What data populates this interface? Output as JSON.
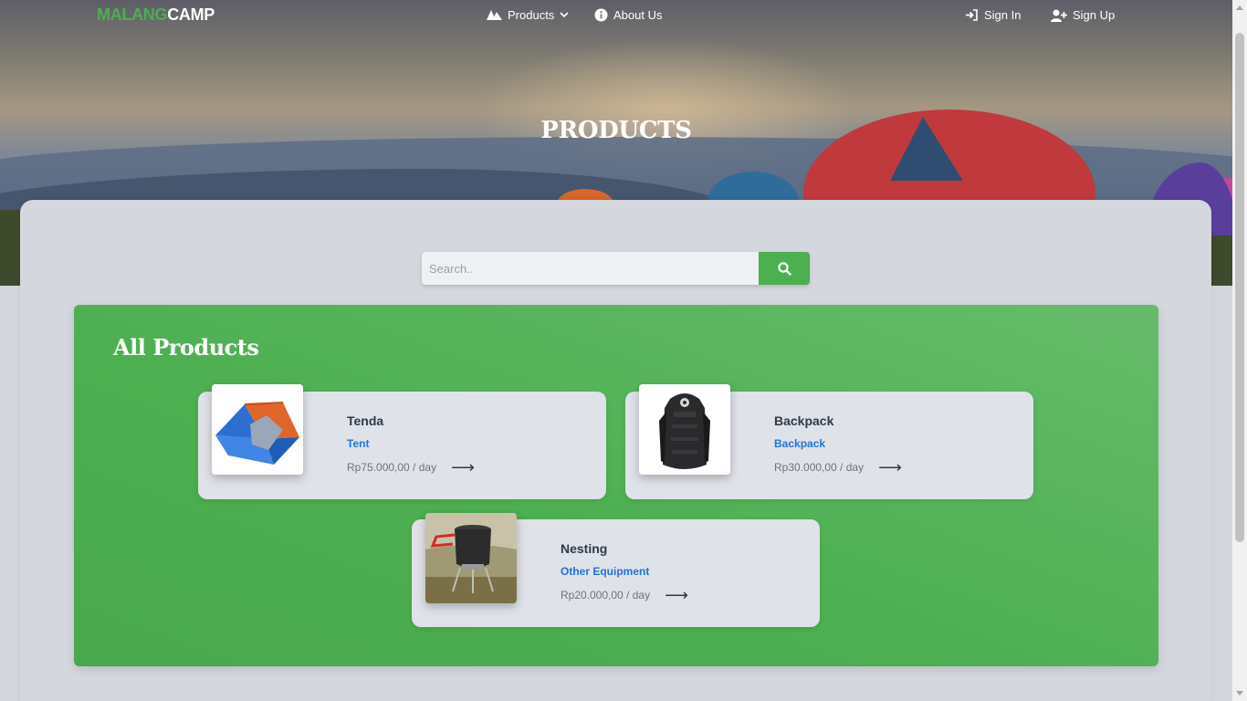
{
  "brand": {
    "part1": "MALANG",
    "part2": "CAMP"
  },
  "nav": {
    "products": "Products",
    "about": "About Us",
    "signin": "Sign In",
    "signup": "Sign Up"
  },
  "page_title": "PRODUCTS",
  "search": {
    "placeholder": "Search..",
    "value": ""
  },
  "section_title": "All Products",
  "products": [
    {
      "name": "Tenda",
      "category": "Tent",
      "price": "Rp75.000,00 / day",
      "arrow": "⟶"
    },
    {
      "name": "Backpack",
      "category": "Backpack",
      "price": "Rp30.000,00 / day",
      "arrow": "⟶"
    },
    {
      "name": "Nesting",
      "category": "Other Equipment",
      "price": "Rp20.000,00 / day",
      "arrow": "⟶"
    }
  ],
  "colors": {
    "accent": "#4caf50",
    "link": "#1e74d8",
    "panel": "#d4d7de"
  }
}
